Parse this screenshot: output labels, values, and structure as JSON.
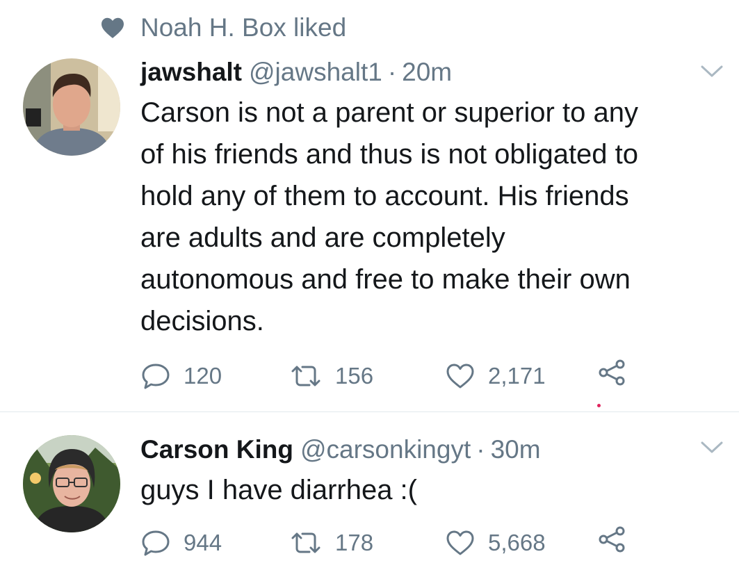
{
  "social_context": {
    "icon": "heart-icon",
    "text": "Noah H. Box liked"
  },
  "tweets": [
    {
      "display_name": "jawshalt",
      "handle": "@jawshalt1",
      "separator": "·",
      "time": "20m",
      "text": "Carson is not a parent or superior to any of his friends and thus is not obligated to hold any of them to account. His friends are adults and are completely autonomous and free to make their own decisions.",
      "lines": [
        "Carson is not a parent or superior to any",
        "of his friends and thus is not obligated to",
        "hold any of them to account. His friends",
        "are adults and are completely",
        "autonomous and free to make their own",
        "decisions."
      ],
      "replies": "120",
      "retweets": "156",
      "likes": "2,171"
    },
    {
      "display_name": "Carson King",
      "handle": "@carsonkingyt",
      "separator": "·",
      "time": "30m",
      "text": "guys I have diarrhea :(",
      "lines": [
        "guys I have diarrhea :("
      ],
      "replies": "944",
      "retweets": "178",
      "likes": "5,668"
    }
  ],
  "colors": {
    "text_primary": "#14171a",
    "text_secondary": "#657786",
    "divider": "#e1e8ed",
    "indicator": "#e0245e"
  }
}
